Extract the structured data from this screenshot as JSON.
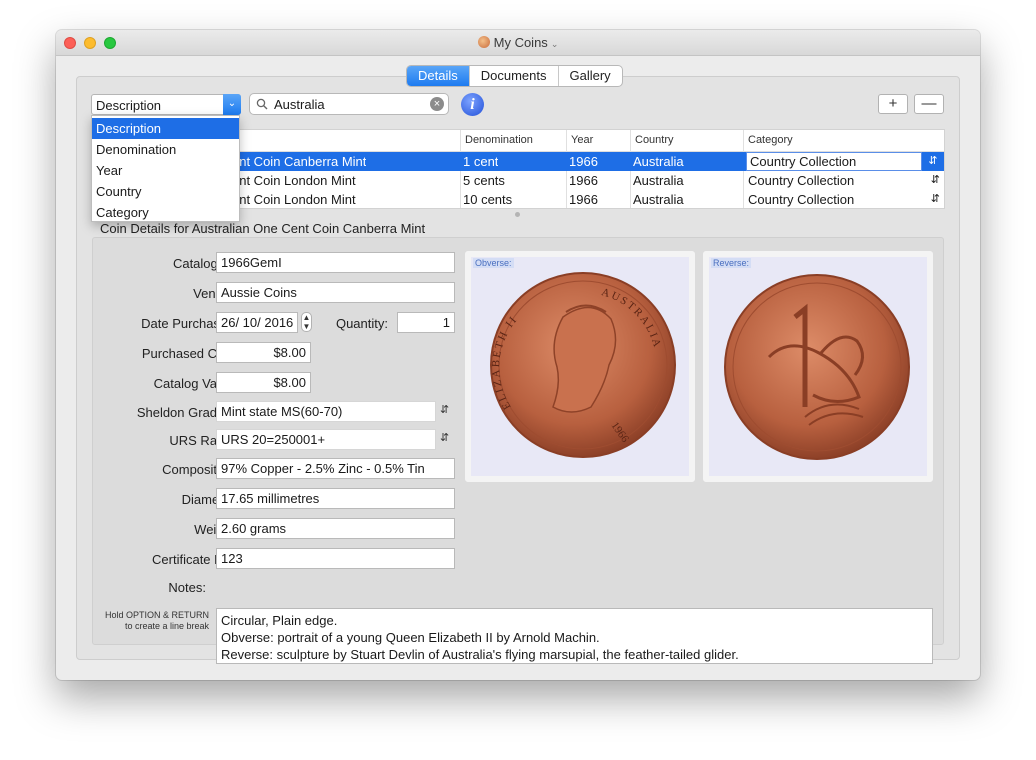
{
  "window": {
    "title": "My Coins"
  },
  "tabs": [
    {
      "label": "Details"
    },
    {
      "label": "Documents"
    },
    {
      "label": "Gallery"
    }
  ],
  "search_field_popup": {
    "selected": "Description"
  },
  "search": {
    "value": "Australia"
  },
  "buttons": {
    "add": "+",
    "remove": "—",
    "info": "i"
  },
  "dropdown": {
    "options": [
      "Description",
      "Denomination",
      "Year",
      "Country",
      "Category"
    ]
  },
  "table": {
    "columns": [
      "Denomination",
      "Year",
      "Country",
      "Category"
    ],
    "rows": [
      {
        "description": "ent Coin Canberra Mint",
        "denomination": "1 cent",
        "year": "1966",
        "country": "Australia",
        "category": "Country Collection"
      },
      {
        "description": "ent Coin London Mint",
        "denomination": "5 cents",
        "year": "1966",
        "country": "Australia",
        "category": "Country Collection"
      },
      {
        "description": "ent Coin London Mint",
        "denomination": "10 cents",
        "year": "1966",
        "country": "Australia",
        "category": "Country Collection"
      }
    ]
  },
  "details": {
    "heading": "Coin Details for Australian One Cent Coin Canberra Mint",
    "labels": {
      "catalog_id": "Catalog ID:",
      "vendor": "Vendor:",
      "date_purchased": "Date Purchased:",
      "quantity": "Quantity:",
      "purchased_cost": "Purchased Cost:",
      "catalog_value": "Catalog Value:",
      "sheldon_grading": "Sheldon Grading:",
      "urs_rarity": "URS Rarity:",
      "composition": "Composition:",
      "diameter": "Diameter:",
      "weight": "Weight:",
      "certificate_no": "Certificate No.:",
      "notes": "Notes:"
    },
    "values": {
      "catalog_id": "1966GemI",
      "vendor": "Aussie Coins",
      "date_purchased": "26/ 10/ 2016",
      "quantity": "1",
      "purchased_cost": "$8.00",
      "catalog_value": "$8.00",
      "sheldon_grading": "Mint state MS(60-70)",
      "urs_rarity": "URS 20=250001+",
      "composition": "97% Copper - 2.5% Zinc - 0.5% Tin",
      "diameter": "17.65 millimetres",
      "weight": "2.60 grams",
      "certificate_no": "123"
    },
    "notes_lines": [
      "Circular, Plain edge.",
      "Obverse: portrait of a young Queen Elizabeth II by Arnold Machin.",
      "Reverse: sculpture by Stuart Devlin of Australia's flying marsupial, the feather-tailed glider."
    ],
    "notes_hint_line1": "Hold OPTION & RETURN",
    "notes_hint_line2": "to create a line break",
    "images": {
      "obverse_caption": "Obverse:",
      "reverse_caption": "Reverse:"
    },
    "coin_text": {
      "obverse_left": "ELIZABETH II",
      "obverse_right": "AUSTRALIA",
      "obverse_year": "1966"
    }
  },
  "colors": {
    "accent": "#1e6ee6",
    "coin": "#c06a48"
  }
}
